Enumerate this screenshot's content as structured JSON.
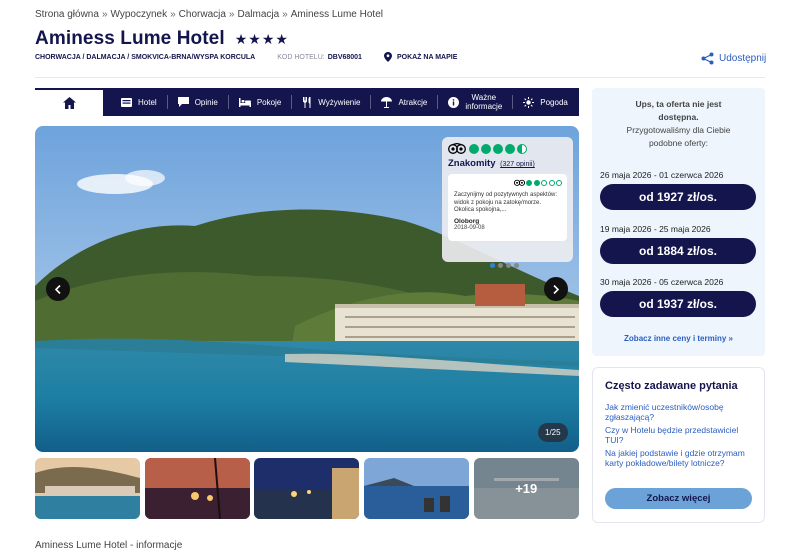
{
  "breadcrumb": [
    "Strona główna",
    "Wypoczynek",
    "Chorwacja",
    "Dalmacja",
    "Aminess Lume Hotel"
  ],
  "breadcrumb_sep": "»",
  "hotel": {
    "name": "Aminess Lume Hotel",
    "stars": "★★★★",
    "location": "CHORWACJA / DALMACJA / SMOKVICA-BRNA/WYSPA KORCULA",
    "code_label": "KOD HOTELU:",
    "code": "DBV68001",
    "map_link": "POKAŻ NA MAPIE",
    "share": "Udostępnij"
  },
  "nav": {
    "items": [
      "Hotel",
      "Opinie",
      "Pokoje",
      "Wyżywienie",
      "Atrakcje",
      "Ważne informacje",
      "Pogoda"
    ],
    "important_l1": "Ważne",
    "important_l2": "informacje"
  },
  "gallery": {
    "counter": "1/25",
    "more_photos": "+19",
    "review": {
      "rating_word": "Znakomity",
      "count": "(327 opinii)",
      "text": "Zaczynijmy od pozytywnych aspektów: widok z pokoju na zatokę/morze. Okolica spokojna,...",
      "author": "Oloborg",
      "date": "2018-09-08"
    }
  },
  "offers": {
    "unavailable_l1": "Ups, ta oferta nie jest dostępna.",
    "unavailable_l2": "Przygotowaliśmy dla Ciebie podobne oferty:",
    "list": [
      {
        "dates": "26 maja 2026 - 01 czerwca 2026",
        "price": "od 1927 zł/os."
      },
      {
        "dates": "19 maja 2026 - 25 maja 2026",
        "price": "od 1884 zł/os."
      },
      {
        "dates": "30 maja 2026 - 05 czerwca 2026",
        "price": "od 1937 zł/os."
      }
    ],
    "more": "Zobacz inne ceny i terminy »"
  },
  "faq": {
    "title": "Często zadawane pytania",
    "questions": [
      "Jak zmienić uczestników/osobę zgłaszającą?",
      "Czy w Hotelu będzie przedstawiciel TUI?",
      "Na jakiej podstawie i gdzie otrzymam karty pokładowe/bilety lotnicze?"
    ],
    "button": "Zobacz więcej"
  },
  "info_heading": "Aminess Lume Hotel - informacje",
  "colors": {
    "navy": "#14154d",
    "link": "#2a5ec0",
    "panel": "#eef5fc",
    "tripadvisor": "#00aa6c"
  }
}
